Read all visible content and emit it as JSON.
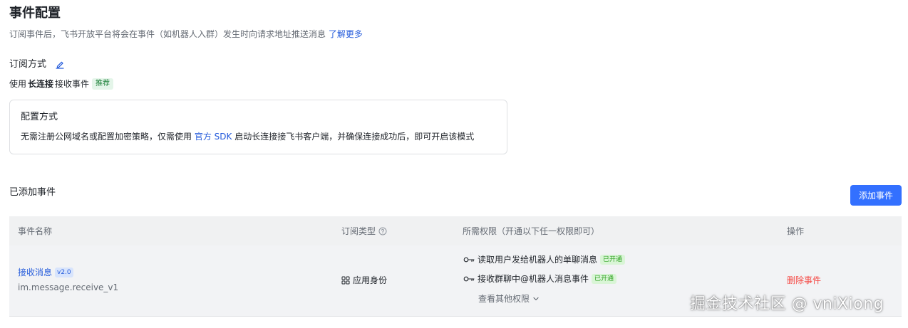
{
  "header": {
    "title": "事件配置",
    "subtitle": "订阅事件后，飞书开放平台将会在事件（如机器人入群）发生时向请求地址推送消息",
    "learn_more": "了解更多"
  },
  "subscription": {
    "label": "订阅方式",
    "edit_icon": "edit-icon",
    "use_prefix": "使用",
    "method": "长连接",
    "use_suffix": "接收事件",
    "recommend_badge": "推荐"
  },
  "config_card": {
    "title": "配置方式",
    "desc_before": "无需注册公网域名或配置加密策略，仅需使用",
    "sdk_link": "官方 SDK",
    "desc_after": "启动长连接接飞书客户端，并确保连接成功后，即可开启该模式"
  },
  "added_events": {
    "title": "已添加事件",
    "add_button": "添加事件"
  },
  "table": {
    "headers": {
      "name": "事件名称",
      "type": "订阅类型",
      "permission": "所需权限（开通以下任一权限即可）",
      "operation": "操作"
    },
    "rows": [
      {
        "event_name": "接收消息",
        "version": "v2.0",
        "event_key": "im.message.receive_v1",
        "subscription_type": "应用身份",
        "permissions": [
          {
            "label": "读取用户发给机器人的单聊消息",
            "status": "已开通"
          },
          {
            "label": "接收群聊中@机器人消息事件",
            "status": "已开通"
          }
        ],
        "more_permissions": "查看其他权限",
        "delete": "删除事件"
      }
    ]
  },
  "watermark": "掘金技术社区 @ vniXiong",
  "colors": {
    "primary": "#3370ff",
    "link": "#245bdb",
    "danger": "#f54a45",
    "success": "#2ea121"
  }
}
